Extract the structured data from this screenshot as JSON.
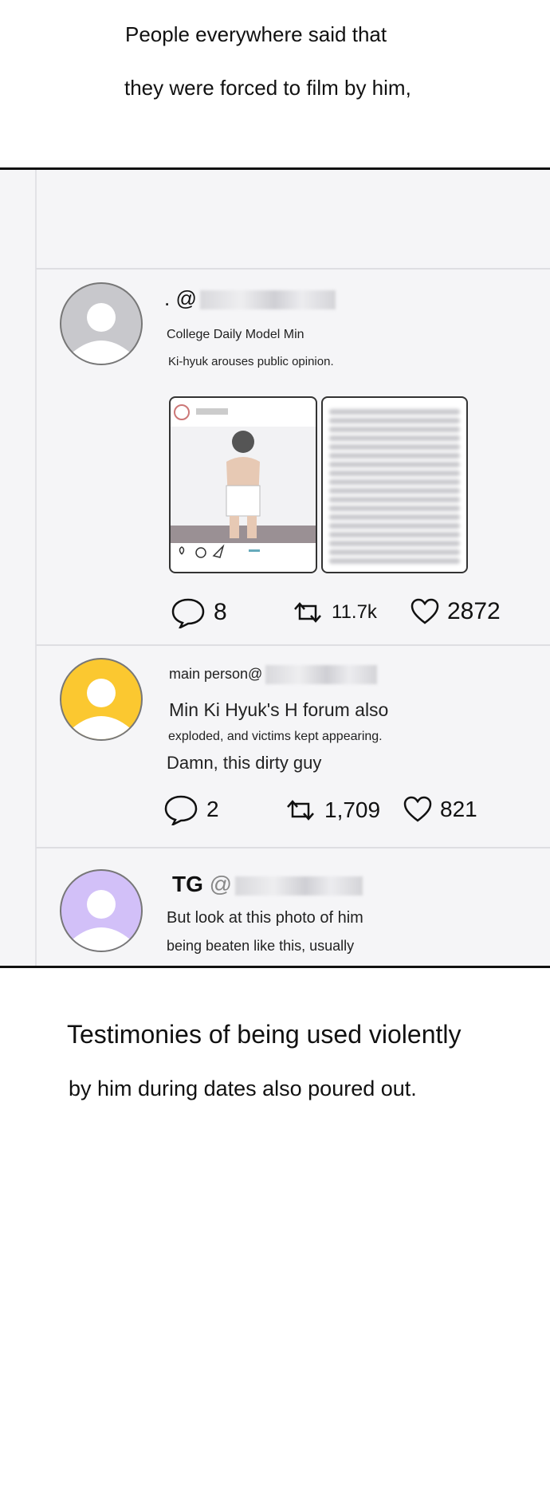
{
  "captions": {
    "top_line1": "People everywhere said that",
    "top_line2": "they were forced to film by him,",
    "bottom_line1": "Testimonies of being used violently",
    "bottom_line2": "by him during dates also poured out."
  },
  "posts": [
    {
      "handle_prefix": ". @",
      "line1": "College Daily Model Min",
      "line2": "Ki-hyuk arouses public opinion.",
      "avatar_color": "#c8c8cc",
      "stats": {
        "comments": "8",
        "retweets": "11.7k",
        "likes": "2872"
      }
    },
    {
      "handle_prefix": "main person@",
      "line1": "Min Ki Hyuk's H forum also",
      "line2": "exploded, and victims kept appearing.",
      "line3": "Damn, this dirty guy",
      "avatar_color": "#fbc830",
      "stats": {
        "comments": "2",
        "retweets": "1,709",
        "likes": "821"
      }
    },
    {
      "handle_name": "TG",
      "handle_at": "@",
      "line1": "But look at this photo of him",
      "line2": "being beaten like this, usually",
      "avatar_color": "#d2c0f8"
    }
  ],
  "icons": [
    "comment-icon",
    "retweet-icon",
    "heart-icon",
    "send-icon",
    "profile-silhouette-icon"
  ]
}
